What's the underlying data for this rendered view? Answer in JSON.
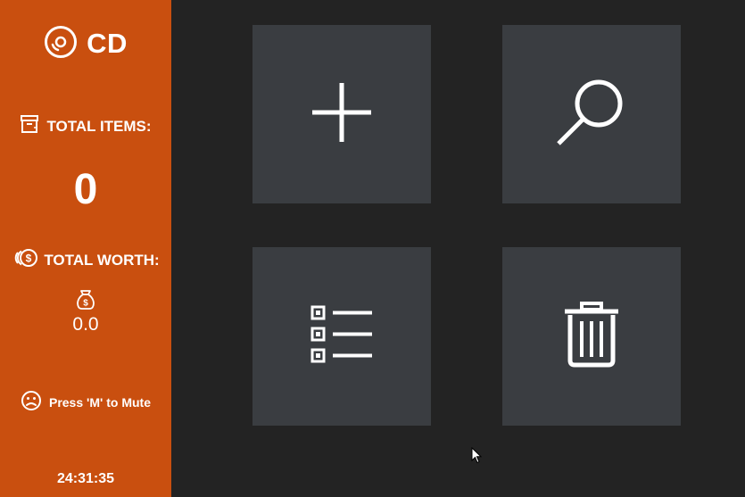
{
  "app": {
    "title": "CD"
  },
  "sidebar": {
    "total_items_label": "TOTAL ITEMS:",
    "total_items_value": "0",
    "total_worth_label": "TOTAL WORTH:",
    "total_worth_value": "0.0",
    "mute_hint": "Press 'M' to Mute",
    "clock": "24:31:35"
  },
  "tiles": [
    {
      "name": "add",
      "icon": "plus-icon"
    },
    {
      "name": "search",
      "icon": "magnifier-icon"
    },
    {
      "name": "list",
      "icon": "checklist-icon"
    },
    {
      "name": "delete",
      "icon": "trash-icon"
    }
  ],
  "colors": {
    "sidebar": "#c94f0f",
    "background": "#232323",
    "tile": "#3a3d41",
    "foreground": "#ffffff"
  }
}
